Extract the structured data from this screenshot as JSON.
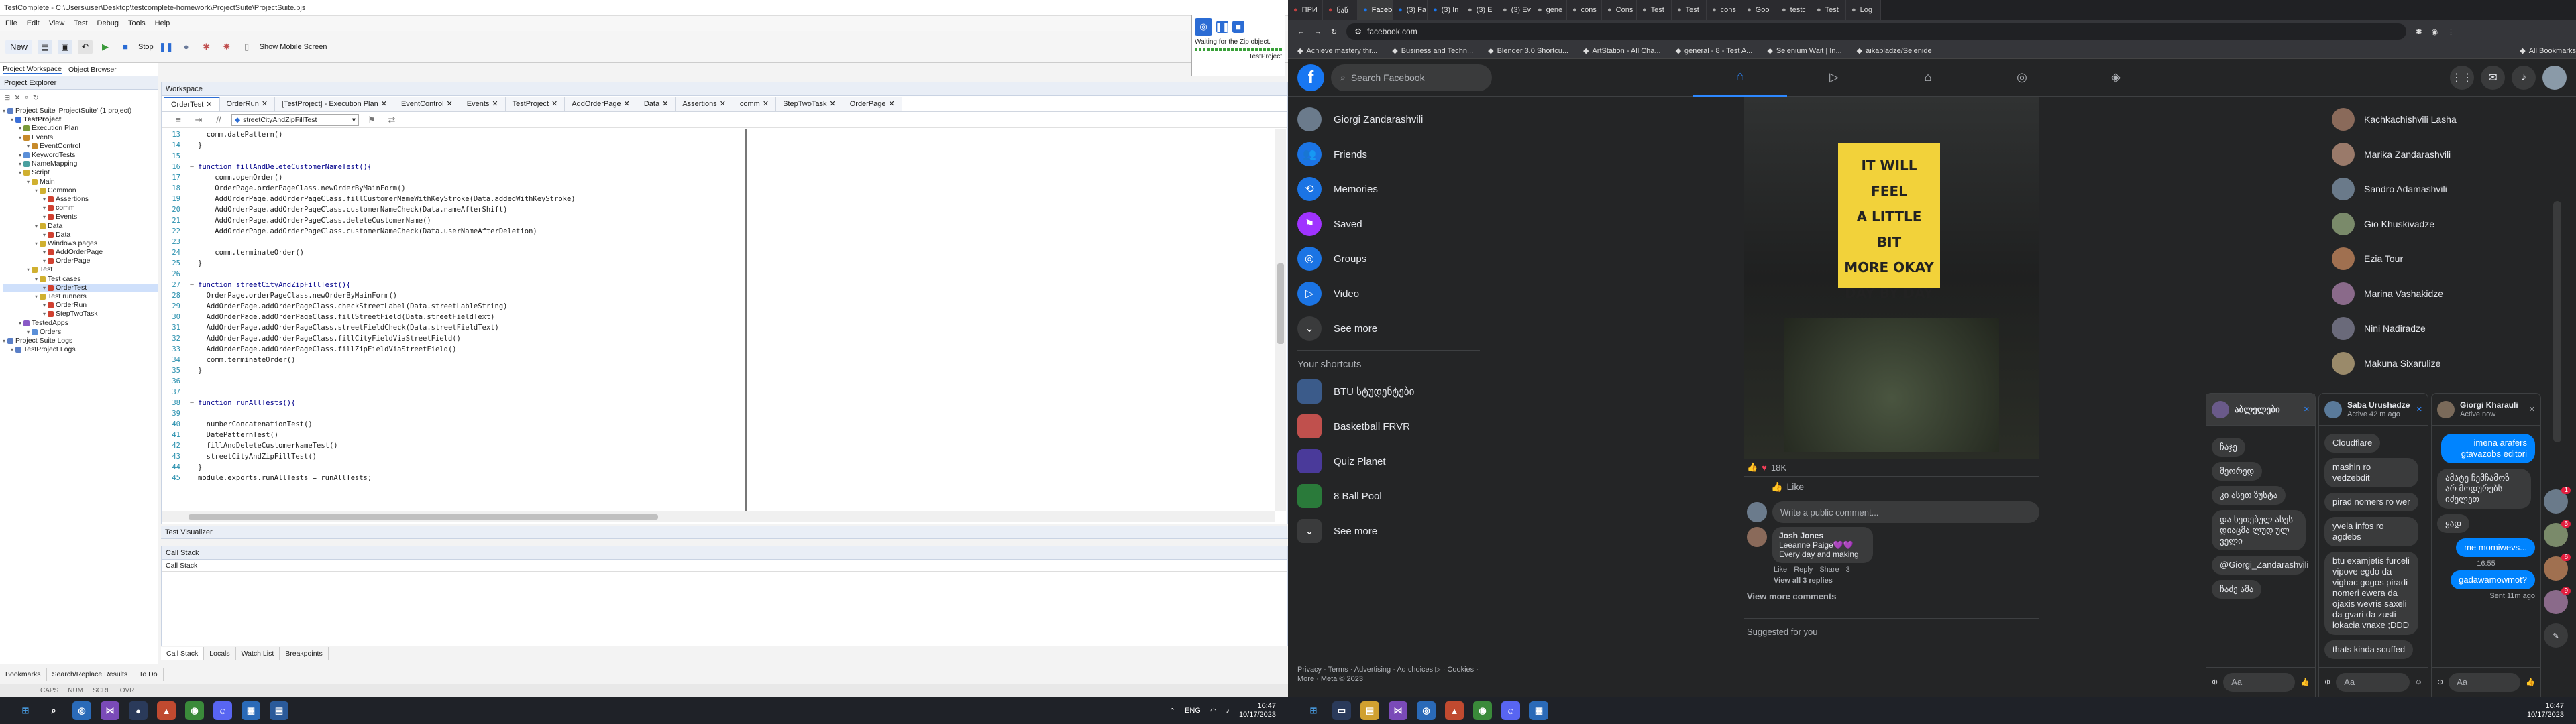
{
  "tc": {
    "title": "TestComplete - C:\\Users\\user\\Desktop\\testcomplete-homework\\ProjectSuite\\ProjectSuite.pjs",
    "menu": [
      "File",
      "Edit",
      "View",
      "Test",
      "Debug",
      "Tools",
      "Help"
    ],
    "toolbar": {
      "new": "New",
      "stop": "Stop",
      "mobile": "Show Mobile Screen"
    },
    "notice": {
      "text": "Waiting for the Zip object.",
      "project": "TestProject"
    },
    "explorer_tabs": [
      "Project Workspace",
      "Object Browser"
    ],
    "explorer_title": "Project Explorer",
    "tree": [
      {
        "label": "Project Suite 'ProjectSuite' (1 project)",
        "d": 0,
        "c": "#5a7fc7"
      },
      {
        "label": "TestProject",
        "d": 1,
        "c": "#3a6fd8",
        "bold": true
      },
      {
        "label": "Execution Plan",
        "d": 2,
        "c": "#7a9a3a"
      },
      {
        "label": "Events",
        "d": 2,
        "c": "#c78a2a"
      },
      {
        "label": "EventControl",
        "d": 3,
        "c": "#c78a2a"
      },
      {
        "label": "KeywordTests",
        "d": 2,
        "c": "#5a8fd8"
      },
      {
        "label": "NameMapping",
        "d": 2,
        "c": "#4aa0a0"
      },
      {
        "label": "Script",
        "d": 2,
        "c": "#d0b030"
      },
      {
        "label": "Main",
        "d": 3,
        "c": "#d0b030"
      },
      {
        "label": "Common",
        "d": 4,
        "c": "#d0b030"
      },
      {
        "label": "Assertions",
        "d": 5,
        "c": "#d04030"
      },
      {
        "label": "comm",
        "d": 5,
        "c": "#d04030"
      },
      {
        "label": "Events",
        "d": 5,
        "c": "#d04030"
      },
      {
        "label": "Data",
        "d": 4,
        "c": "#d0b030"
      },
      {
        "label": "Data",
        "d": 5,
        "c": "#d04030"
      },
      {
        "label": "Windows.pages",
        "d": 4,
        "c": "#d0b030"
      },
      {
        "label": "AddOrderPage",
        "d": 5,
        "c": "#d04030"
      },
      {
        "label": "OrderPage",
        "d": 5,
        "c": "#d04030"
      },
      {
        "label": "Test",
        "d": 3,
        "c": "#d0b030"
      },
      {
        "label": "Test cases",
        "d": 4,
        "c": "#d0b030"
      },
      {
        "label": "OrderTest",
        "d": 5,
        "c": "#d04030",
        "sel": true
      },
      {
        "label": "Test runners",
        "d": 4,
        "c": "#d0b030"
      },
      {
        "label": "OrderRun",
        "d": 5,
        "c": "#d04030"
      },
      {
        "label": "StepTwoTask",
        "d": 5,
        "c": "#d04030"
      },
      {
        "label": "TestedApps",
        "d": 2,
        "c": "#8a5ac7"
      },
      {
        "label": "Orders",
        "d": 3,
        "c": "#5a8fd8"
      },
      {
        "label": "Project Suite Logs",
        "d": 0,
        "c": "#5a7fc7"
      },
      {
        "label": "TestProject Logs",
        "d": 1,
        "c": "#5a7fc7"
      }
    ],
    "workspace_title": "Workspace",
    "tabs": [
      "OrderTest",
      "OrderRun",
      "[TestProject] - Execution Plan",
      "EventControl",
      "Events",
      "TestProject",
      "AddOrderPage",
      "Data",
      "Assertions",
      "comm",
      "StepTwoTask",
      "OrderPage"
    ],
    "func_dropdown": "streetCityAndZipFillTest",
    "code": [
      {
        "n": "13",
        "t": "  comm.datePattern()",
        "f": ""
      },
      {
        "n": "14",
        "t": "}",
        "f": ""
      },
      {
        "n": "15",
        "t": "",
        "f": ""
      },
      {
        "n": "16",
        "t": "function fillAndDeleteCustomerNameTest(){",
        "f": "−",
        "kw": true
      },
      {
        "n": "17",
        "t": "    comm.openOrder()",
        "f": ""
      },
      {
        "n": "18",
        "t": "    OrderPage.orderPageClass.newOrderByMainForm()",
        "f": ""
      },
      {
        "n": "19",
        "t": "    AddOrderPage.addOrderPageClass.fillCustomerNameWithKeyStroke(Data.addedWithKeyStroke)",
        "f": ""
      },
      {
        "n": "20",
        "t": "    AddOrderPage.addOrderPageClass.customerNameCheck(Data.nameAfterShift)",
        "f": ""
      },
      {
        "n": "21",
        "t": "    AddOrderPage.addOrderPageClass.deleteCustomerName()",
        "f": ""
      },
      {
        "n": "22",
        "t": "    AddOrderPage.addOrderPageClass.customerNameCheck(Data.userNameAfterDeletion)",
        "f": ""
      },
      {
        "n": "23",
        "t": "",
        "f": ""
      },
      {
        "n": "24",
        "t": "    comm.terminateOrder()",
        "f": ""
      },
      {
        "n": "25",
        "t": "}",
        "f": ""
      },
      {
        "n": "26",
        "t": "",
        "f": ""
      },
      {
        "n": "27",
        "t": "function streetCityAndZipFillTest(){",
        "f": "−",
        "kw": true
      },
      {
        "n": "28",
        "t": "  OrderPage.orderPageClass.newOrderByMainForm()",
        "f": ""
      },
      {
        "n": "29",
        "t": "  AddOrderPage.addOrderPageClass.checkStreetLabel(Data.streetLableString)",
        "f": ""
      },
      {
        "n": "30",
        "t": "  AddOrderPage.addOrderPageClass.fillStreetField(Data.streetFieldText)",
        "f": ""
      },
      {
        "n": "31",
        "t": "  AddOrderPage.addOrderPageClass.streetFieldCheck(Data.streetFieldText)",
        "f": ""
      },
      {
        "n": "32",
        "t": "  AddOrderPage.addOrderPageClass.fillCityFieldViaStreetField()",
        "f": ""
      },
      {
        "n": "33",
        "t": "  AddOrderPage.addOrderPageClass.fillZipFieldViaStreetField()",
        "f": ""
      },
      {
        "n": "34",
        "t": "  comm.terminateOrder()",
        "f": ""
      },
      {
        "n": "35",
        "t": "}",
        "f": ""
      },
      {
        "n": "36",
        "t": "",
        "f": ""
      },
      {
        "n": "37",
        "t": "",
        "f": ""
      },
      {
        "n": "38",
        "t": "function runAllTests(){",
        "f": "−",
        "kw": true
      },
      {
        "n": "39",
        "t": "",
        "f": ""
      },
      {
        "n": "40",
        "t": "  numberConcatenationTest()",
        "f": ""
      },
      {
        "n": "41",
        "t": "  DatePatternTest()",
        "f": ""
      },
      {
        "n": "42",
        "t": "  fillAndDeleteCustomerNameTest()",
        "f": ""
      },
      {
        "n": "43",
        "t": "  streetCityAndZipFillTest()",
        "f": ""
      },
      {
        "n": "44",
        "t": "}",
        "f": ""
      },
      {
        "n": "45",
        "t": "module.exports.runAllTests = runAllTests;",
        "f": ""
      }
    ],
    "visualizer": "Test Visualizer",
    "callstack": {
      "title": "Call Stack",
      "col": "Call Stack"
    },
    "bottom_tabs": [
      "Call Stack",
      "Locals",
      "Watch List",
      "Breakpoints"
    ],
    "left_bottom_tabs": [
      "Bookmarks",
      "Search/Replace Results",
      "To Do"
    ],
    "status": [
      "CAPS",
      "NUM",
      "SCRL",
      "OVR"
    ],
    "clock": {
      "time": "16:47",
      "date": "10/17/2023"
    },
    "lang": "ENG"
  },
  "fb": {
    "tabs": [
      "ПРИ",
      "ნაწ",
      "Faceb",
      "(3) Fa",
      "(3) In",
      "(3) E",
      "(3) Ev",
      "gene",
      "cons",
      "Cons",
      "Test",
      "Test",
      "cons",
      "Goo",
      "testc",
      "Test",
      "Log"
    ],
    "url": "facebook.com",
    "bookmarks": [
      "Achieve mastery thr...",
      "Business and Techn...",
      "Blender 3.0 Shortcu...",
      "ArtStation - All Cha...",
      "general - 8 - Test A...",
      "Selenium Wait | In...",
      "aikabladze/Selenide",
      "All Bookmarks"
    ],
    "search": "Search Facebook",
    "left": [
      {
        "label": "Giorgi Zandarashvili",
        "c": "#6b7b8c"
      },
      {
        "label": "Friends",
        "c": "#1b74e4"
      },
      {
        "label": "Memories",
        "c": "#1b74e4"
      },
      {
        "label": "Saved",
        "c": "#a033ff"
      },
      {
        "label": "Groups",
        "c": "#1b74e4"
      },
      {
        "label": "Video",
        "c": "#1b74e4"
      },
      {
        "label": "See more",
        "c": "#3a3b3c"
      }
    ],
    "shortcuts_title": "Your shortcuts",
    "shortcuts": [
      {
        "label": "BTU სტუდენტები",
        "c": "#3b5b8a"
      },
      {
        "label": "Basketball FRVR",
        "c": "#c0504d"
      },
      {
        "label": "Quiz Planet",
        "c": "#4a3a9a"
      },
      {
        "label": "8 Ball Pool",
        "c": "#2a7a3a"
      },
      {
        "label": "See more",
        "c": "#3a3b3c"
      }
    ],
    "footer": "Privacy · Terms · Advertising · Ad choices ▷ · Cookies · More · Meta © 2023",
    "post": {
      "sign": [
        "IT WILL FEEL",
        "A LITTLE BIT",
        "MORE OKAY",
        "DAY BY DAY"
      ],
      "reactions": "18K",
      "like": "Like",
      "comment_ph": "Write a public comment...",
      "commenter": "Josh Jones",
      "comment": "Leeanne Paige💜💜 Every day and making",
      "view": "View all 3 replies",
      "view_more": "View more comments",
      "c_actions": [
        "Like",
        "Reply",
        "Share",
        "3"
      ]
    },
    "suggested": "Suggested for you",
    "contacts": [
      "Kachkachishvili Lasha",
      "Marika Zandarashvili",
      "Sandro Adamashvili",
      "Gio Khuskivadze",
      "Ezia Tour",
      "Marina Vashakidze",
      "Nini Nadiradze",
      "Makuna Sixarulize"
    ],
    "chat1": {
      "name": "აბლელები",
      "msgs": [
        {
          "t": "ჩაჯე",
          "o": false
        },
        {
          "t": "მეორედ",
          "o": false
        },
        {
          "t": "კი ასეთ ზუსტა",
          "o": false
        },
        {
          "t": "და ხეთებულ ასეს დიაცმა ლუდ ულ ველი",
          "o": false
        },
        {
          "t": "@Giorgi_Zandarashvili",
          "o": false
        },
        {
          "t": "ჩაძე ამა",
          "o": false
        }
      ],
      "aa": "Aa"
    },
    "chat2": {
      "name": "Saba Urushadze",
      "sub": "Active 42 m ago",
      "msgs": [
        {
          "t": "Cloudflare",
          "o": false
        },
        {
          "t": "mashin ro vedzebdit",
          "o": false
        },
        {
          "t": "pirad nomers ro wer",
          "o": false
        },
        {
          "t": "yvela infos ro agdebs",
          "o": false
        },
        {
          "t": "btu examjetis furceli vipove egdo da vighac gogos piradi nomeri ewera da ojaxis wevris saxeli da gvari da zusti lokacia vnaxe ;DDD",
          "o": false
        },
        {
          "t": "thats kinda scuffed",
          "o": false
        }
      ],
      "aa": "Aa"
    },
    "chat3": {
      "name": "Giorgi Kharauli",
      "sub": "Active now",
      "msgs": [
        {
          "t": "imena arafers gtavazobs editori",
          "o": true
        },
        {
          "t": "ამატე ჩემჩამოზ არ მოდურებს იძელეთ",
          "o": false
        },
        {
          "t": "ყად",
          "o": false
        },
        {
          "t": "me momiwevs...",
          "o": true
        },
        {
          "t": "gadawamowmot?",
          "o": true
        }
      ],
      "time": "16:55",
      "sent": "Sent 11m ago",
      "aa": "Aa"
    },
    "badges": [
      "1",
      "5",
      "6",
      "9"
    ],
    "clock": {
      "time": "16:47",
      "date": "10/17/2023"
    }
  }
}
